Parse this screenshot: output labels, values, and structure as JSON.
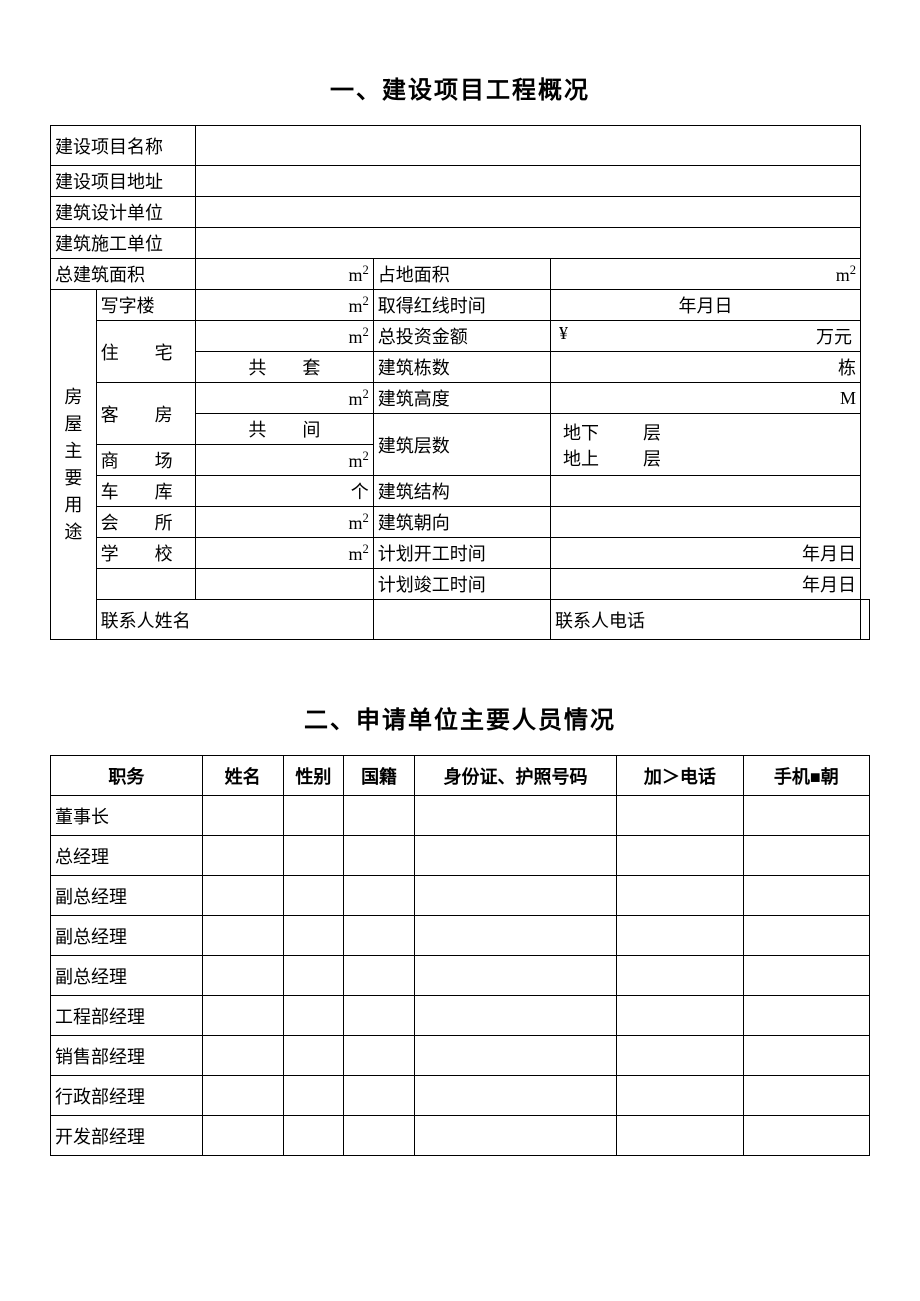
{
  "section1": {
    "title": "一、建设项目工程概况",
    "labels": {
      "projectName": "建设项目名称",
      "projectAddr": "建设项目地址",
      "designUnit": "建筑设计单位",
      "constructUnit": "建筑施工单位",
      "totalArea": "总建筑面积",
      "landArea": "占地面积",
      "mainUse": "房屋主要用途",
      "office": "写字楼",
      "residence": "住　　宅",
      "guestRoom": "客　　房",
      "mall": "商　　场",
      "garage": "车　　库",
      "club": "会　　所",
      "school": "学　　校",
      "redlineTime": "取得红线时间",
      "investAmount": "总投资金额",
      "buildingCount": "建筑栋数",
      "buildingHeight": "建筑高度",
      "buildingFloors": "建筑层数",
      "buildingStruct": "建筑结构",
      "buildingOrient": "建筑朝向",
      "planStart": "计划开工时间",
      "planEnd": "计划竣工时间",
      "contactName": "联系人姓名",
      "contactPhone": "联系人电话"
    },
    "units": {
      "m2": "m",
      "sets": "共　　套",
      "rooms": "共　　间",
      "ge": "个",
      "dong": "栋",
      "M": "M",
      "wanyuan": "万元",
      "yen": "¥",
      "underground": "地下",
      "above": "地上",
      "ceng": "层",
      "ymd": "年月日"
    }
  },
  "section2": {
    "title": "二、申请单位主要人员情况",
    "headers": {
      "position": "职务",
      "name": "姓名",
      "gender": "性别",
      "nationality": "国籍",
      "idNo": "身份证、护照号码",
      "phone": "加＞电话",
      "mobile": "手机■朝"
    },
    "positions": [
      "董事长",
      "总经理",
      "副总经理",
      "副总经理",
      "副总经理",
      "工程部经理",
      "销售部经理",
      "行政部经理",
      "开发部经理"
    ]
  }
}
